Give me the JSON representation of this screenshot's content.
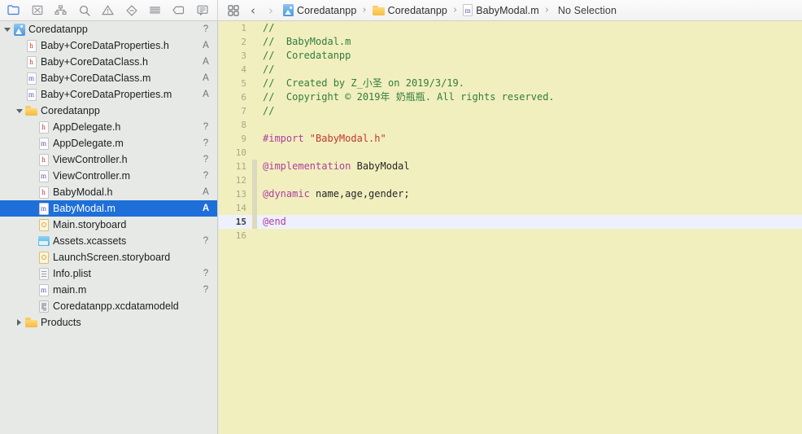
{
  "toolbar": {
    "navigator_icons": [
      {
        "name": "project-navigator-icon",
        "label": "Project Navigator",
        "active": true
      },
      {
        "name": "source-control-navigator-icon",
        "label": "Source Control Navigator",
        "active": false
      },
      {
        "name": "symbol-navigator-icon",
        "label": "Symbol Navigator",
        "active": false
      },
      {
        "name": "find-navigator-icon",
        "label": "Find Navigator",
        "active": false
      },
      {
        "name": "issue-navigator-icon",
        "label": "Issue Navigator",
        "active": false
      },
      {
        "name": "test-navigator-icon",
        "label": "Test Navigator",
        "active": false
      },
      {
        "name": "debug-navigator-icon",
        "label": "Debug Navigator",
        "active": false
      },
      {
        "name": "breakpoint-navigator-icon",
        "label": "Breakpoint Navigator",
        "active": false
      },
      {
        "name": "report-navigator-icon",
        "label": "Report Navigator",
        "active": false
      }
    ],
    "jumpbar": {
      "grid_icon": "related-items-icon",
      "back_label": "‹",
      "forward_label": "›",
      "separator": "›",
      "crumbs": [
        {
          "label": "Coredatanpp",
          "icon": "xcode-project-icon"
        },
        {
          "label": "Coredatanpp",
          "icon": "folder-icon"
        },
        {
          "label": "BabyModal.m",
          "icon": "objc-implementation-file-icon"
        },
        {
          "label": "No Selection",
          "icon": "none"
        }
      ]
    }
  },
  "navigator": {
    "rows": [
      {
        "label": "Coredatanpp",
        "indent": 0,
        "icon": "xcode-project-icon",
        "status": "?",
        "twisty": "open",
        "selected": false
      },
      {
        "label": "Baby+CoreDataProperties.h",
        "indent": 1,
        "icon": "header-file-icon",
        "status": "A",
        "twisty": "none",
        "selected": false
      },
      {
        "label": "Baby+CoreDataClass.h",
        "indent": 1,
        "icon": "header-file-icon",
        "status": "A",
        "twisty": "none",
        "selected": false
      },
      {
        "label": "Baby+CoreDataClass.m",
        "indent": 1,
        "icon": "objc-implementation-file-icon",
        "status": "A",
        "twisty": "none",
        "selected": false
      },
      {
        "label": "Baby+CoreDataProperties.m",
        "indent": 1,
        "icon": "objc-implementation-file-icon",
        "status": "A",
        "twisty": "none",
        "selected": false
      },
      {
        "label": "Coredatanpp",
        "indent": 1,
        "icon": "folder-icon",
        "status": "",
        "twisty": "open",
        "selected": false
      },
      {
        "label": "AppDelegate.h",
        "indent": 2,
        "icon": "header-file-icon",
        "status": "?",
        "twisty": "none",
        "selected": false
      },
      {
        "label": "AppDelegate.m",
        "indent": 2,
        "icon": "objc-implementation-file-icon",
        "status": "?",
        "twisty": "none",
        "selected": false
      },
      {
        "label": "ViewController.h",
        "indent": 2,
        "icon": "header-file-icon",
        "status": "?",
        "twisty": "none",
        "selected": false
      },
      {
        "label": "ViewController.m",
        "indent": 2,
        "icon": "objc-implementation-file-icon",
        "status": "?",
        "twisty": "none",
        "selected": false
      },
      {
        "label": "BabyModal.h",
        "indent": 2,
        "icon": "header-file-icon",
        "status": "A",
        "twisty": "none",
        "selected": false
      },
      {
        "label": "BabyModal.m",
        "indent": 2,
        "icon": "objc-implementation-file-icon",
        "status": "A",
        "twisty": "none",
        "selected": true
      },
      {
        "label": "Main.storyboard",
        "indent": 2,
        "icon": "storyboard-icon",
        "status": "",
        "twisty": "none",
        "selected": false
      },
      {
        "label": "Assets.xcassets",
        "indent": 2,
        "icon": "assets-catalog-icon",
        "status": "?",
        "twisty": "none",
        "selected": false
      },
      {
        "label": "LaunchScreen.storyboard",
        "indent": 2,
        "icon": "storyboard-icon",
        "status": "",
        "twisty": "none",
        "selected": false
      },
      {
        "label": "Info.plist",
        "indent": 2,
        "icon": "plist-icon",
        "status": "?",
        "twisty": "none",
        "selected": false
      },
      {
        "label": "main.m",
        "indent": 2,
        "icon": "objc-implementation-file-icon",
        "status": "?",
        "twisty": "none",
        "selected": false
      },
      {
        "label": "Coredatanpp.xcdatamodeld",
        "indent": 2,
        "icon": "datamodel-icon",
        "status": "",
        "twisty": "none",
        "selected": false
      },
      {
        "label": "Products",
        "indent": 1,
        "icon": "folder-icon",
        "status": "",
        "twisty": "closed",
        "selected": false
      }
    ]
  },
  "editor": {
    "current_line": 15,
    "fold_ribbon_lines": [
      11,
      12,
      13,
      14,
      15
    ],
    "colors": {
      "background": "#f2efbe",
      "comment": "#2f7d3f",
      "keyword": "#ad3fa0",
      "string": "#c0392b",
      "identifier": "#24262a",
      "current_line": "#eef1fd",
      "gutter_text": "#a9a68a"
    },
    "lines": [
      {
        "n": 1,
        "tokens": [
          {
            "t": "//",
            "c": "cm"
          }
        ]
      },
      {
        "n": 2,
        "tokens": [
          {
            "t": "//  BabyModal.m",
            "c": "cm"
          }
        ]
      },
      {
        "n": 3,
        "tokens": [
          {
            "t": "//  Coredatanpp",
            "c": "cm"
          }
        ]
      },
      {
        "n": 4,
        "tokens": [
          {
            "t": "//",
            "c": "cm"
          }
        ]
      },
      {
        "n": 5,
        "tokens": [
          {
            "t": "//  Created by Z_小圣 on 2019/3/19.",
            "c": "cm"
          }
        ]
      },
      {
        "n": 6,
        "tokens": [
          {
            "t": "//  Copyright © 2019年 奶瓶瓶. All rights reserved.",
            "c": "cm"
          }
        ]
      },
      {
        "n": 7,
        "tokens": [
          {
            "t": "//",
            "c": "cm"
          }
        ]
      },
      {
        "n": 8,
        "tokens": []
      },
      {
        "n": 9,
        "tokens": [
          {
            "t": "#import ",
            "c": "kw"
          },
          {
            "t": "\"BabyModal.h\"",
            "c": "str"
          }
        ]
      },
      {
        "n": 10,
        "tokens": []
      },
      {
        "n": 11,
        "tokens": [
          {
            "t": "@implementation",
            "c": "kw"
          },
          {
            "t": " BabyModal",
            "c": "id"
          }
        ]
      },
      {
        "n": 12,
        "tokens": []
      },
      {
        "n": 13,
        "tokens": [
          {
            "t": "@dynamic",
            "c": "kw"
          },
          {
            "t": " name,age,gender;",
            "c": "id"
          }
        ]
      },
      {
        "n": 14,
        "tokens": []
      },
      {
        "n": 15,
        "tokens": [
          {
            "t": "@end",
            "c": "kw"
          }
        ]
      },
      {
        "n": 16,
        "tokens": []
      }
    ]
  }
}
